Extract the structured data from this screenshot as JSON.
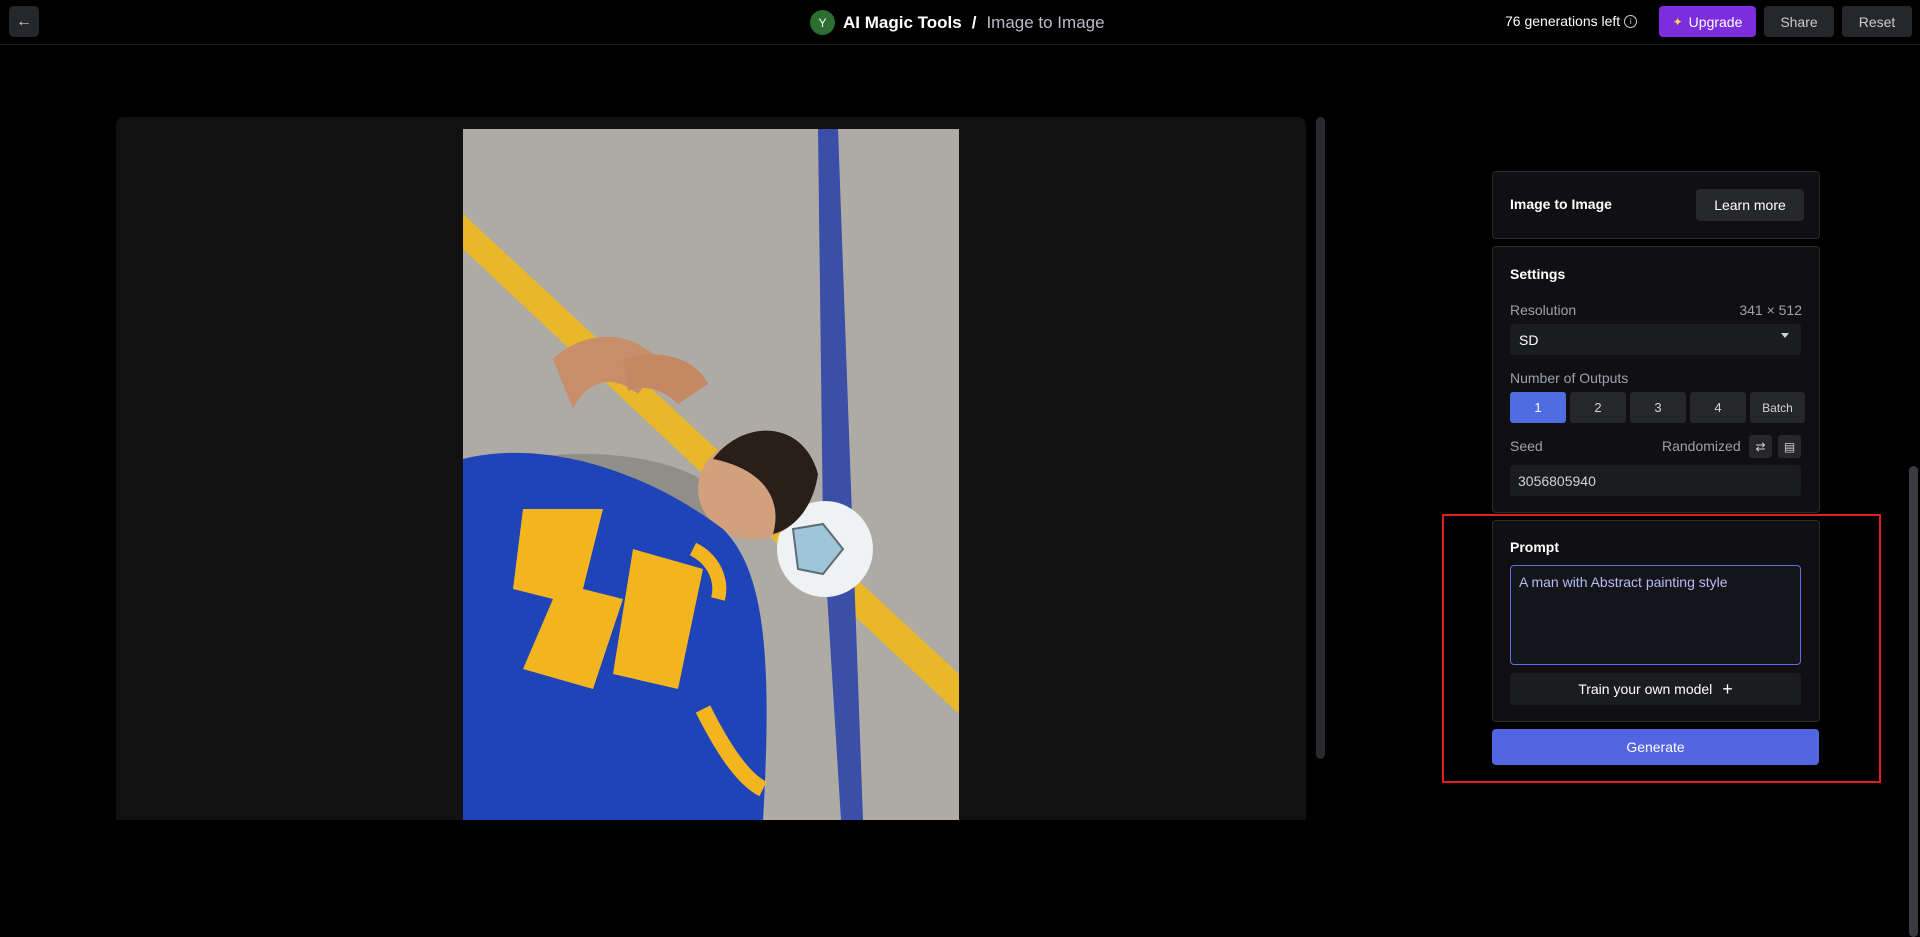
{
  "header": {
    "back_icon": "arrow-left-icon",
    "avatar_letter": "Y",
    "app_name": "AI Magic Tools",
    "separator": "/",
    "tool_name": "Image to Image",
    "generations_left": "76 generations left",
    "upgrade_label": "Upgrade",
    "share_label": "Share",
    "reset_label": "Reset"
  },
  "tool_card": {
    "title": "Image to Image",
    "learn_more_label": "Learn more"
  },
  "settings": {
    "title": "Settings",
    "resolution_label": "Resolution",
    "resolution_value": "341 × 512",
    "resolution_option": "SD",
    "outputs_label": "Number of Outputs",
    "outputs": [
      "1",
      "2",
      "3",
      "4",
      "Batch"
    ],
    "outputs_selected": "1",
    "seed_label": "Seed",
    "seed_mode": "Randomized",
    "seed_value": "3056805940"
  },
  "prompt": {
    "title": "Prompt",
    "text": "A man with Abstract painting style",
    "train_label": "Train your own model",
    "generate_label": "Generate"
  },
  "colors": {
    "accent": "#5166e0",
    "upgrade": "#7d2de0",
    "highlight": "#e0201e"
  }
}
